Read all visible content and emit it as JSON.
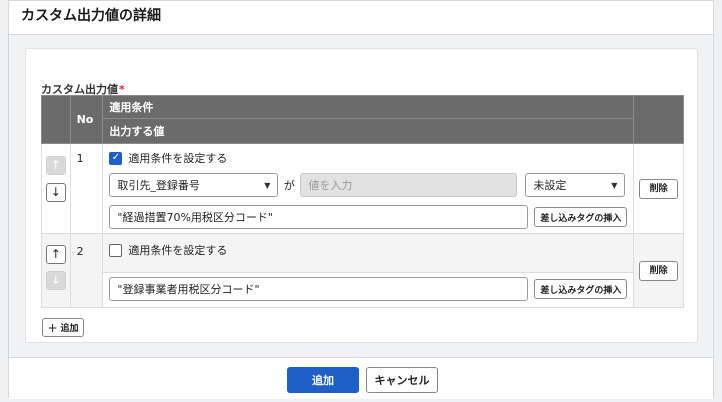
{
  "dialog": {
    "title": "カスタム出力値の詳細",
    "field_label": "カスタム出力値",
    "required_mark": "*",
    "table": {
      "col_no": "No",
      "col_condition": "適用条件",
      "col_output": "出力する値"
    },
    "rows": [
      {
        "no": "1",
        "condition_checkbox_label": "適用条件を設定する",
        "condition_checked": true,
        "condition_field": "取引先_登録番号",
        "connector": "が",
        "condition_value_placeholder": "値を入力",
        "operator": "未設定",
        "output_value": "\"経過措置70%用税区分コード\"",
        "insert_tag_label": "差し込みタグの挿入",
        "delete_label": "削除",
        "up_arrow": "↑",
        "down_arrow": "↓"
      },
      {
        "no": "2",
        "condition_checkbox_label": "適用条件を設定する",
        "condition_checked": false,
        "output_value": "\"登録事業者用税区分コード\"",
        "insert_tag_label": "差し込みタグの挿入",
        "delete_label": "削除",
        "up_arrow": "↑",
        "down_arrow": "↓"
      }
    ],
    "add_row_label": "追加",
    "add_row_icon": "+",
    "footer": {
      "add_label": "追加",
      "cancel_label": "キャンセル"
    },
    "colors": {
      "primary": "#1d5ec7",
      "table_header": "#6b6b6b",
      "required": "#d3263a"
    }
  }
}
